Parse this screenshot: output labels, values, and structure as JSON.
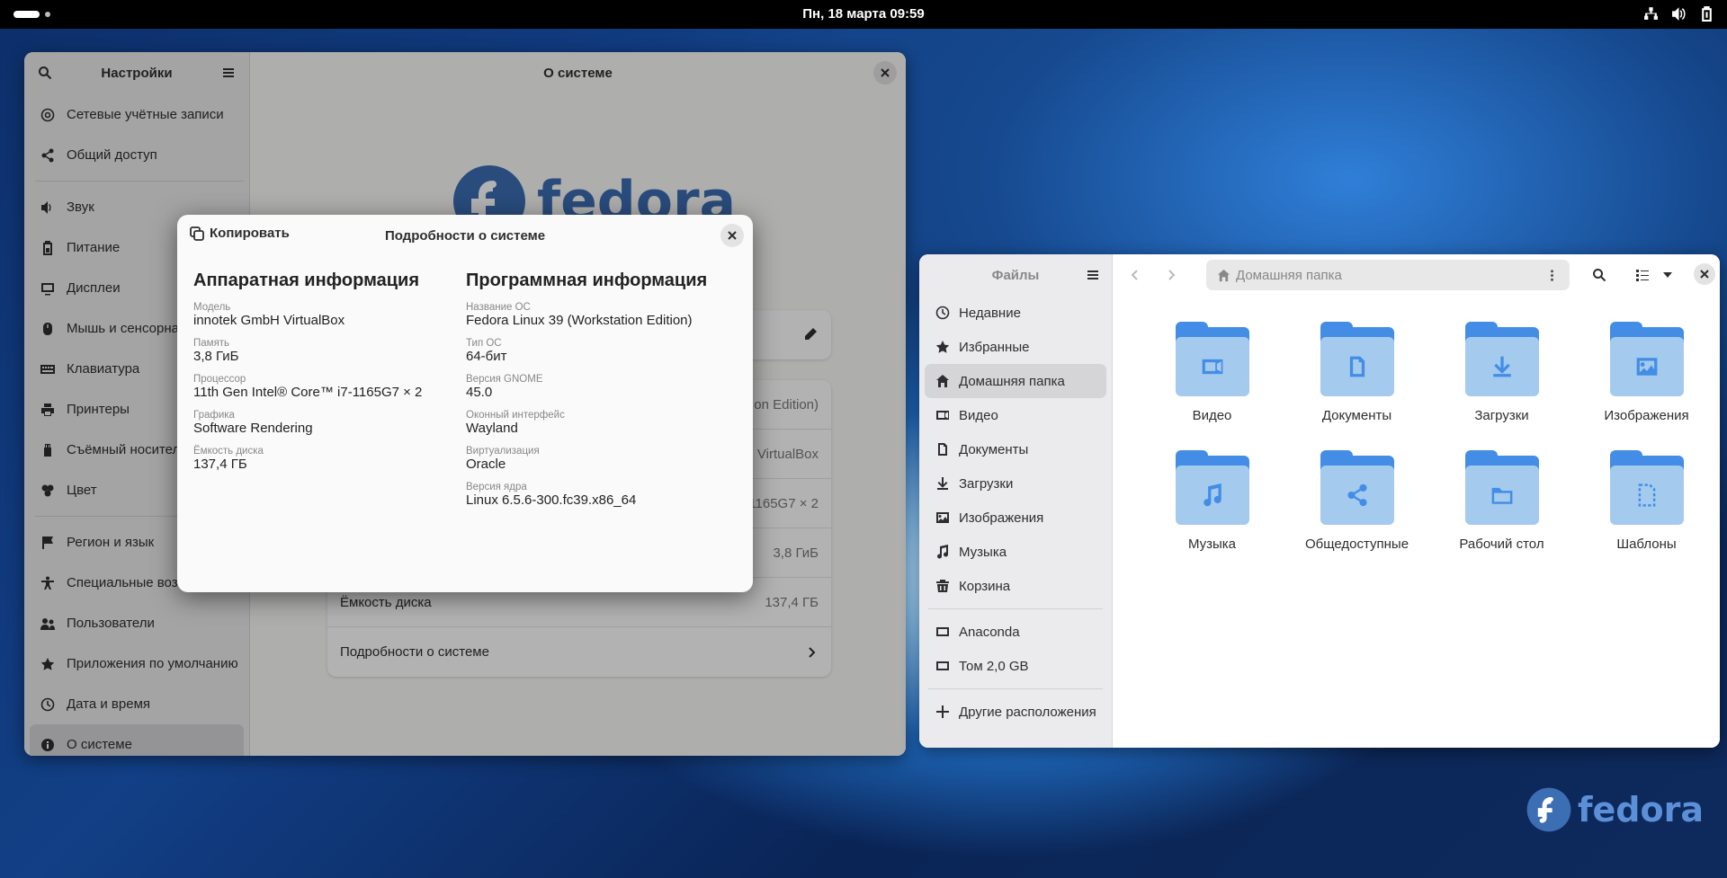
{
  "topbar": {
    "clock": "Пн, 18 марта  09:59"
  },
  "settings": {
    "title": "Настройки",
    "page_title": "О системе",
    "sidebar": [
      {
        "label": "Сетевые учётные записи",
        "icon": "at-icon"
      },
      {
        "label": "Общий доступ",
        "icon": "share-icon"
      },
      {
        "sep": true
      },
      {
        "label": "Звук",
        "icon": "speaker-icon"
      },
      {
        "label": "Питание",
        "icon": "battery-icon"
      },
      {
        "label": "Дисплеи",
        "icon": "display-icon"
      },
      {
        "label": "Мышь и сенсорная",
        "icon": "mouse-icon"
      },
      {
        "label": "Клавиатура",
        "icon": "keyboard-icon"
      },
      {
        "label": "Принтеры",
        "icon": "printer-icon"
      },
      {
        "label": "Съёмный носитель",
        "icon": "usb-icon"
      },
      {
        "label": "Цвет",
        "icon": "color-icon"
      },
      {
        "sep": true
      },
      {
        "label": "Регион и язык",
        "icon": "flag-icon"
      },
      {
        "label": "Специальные возм",
        "icon": "accessibility-icon"
      },
      {
        "label": "Пользователи",
        "icon": "users-icon"
      },
      {
        "label": "Приложения по умолчанию",
        "icon": "star-icon"
      },
      {
        "label": "Дата и время",
        "icon": "clock-icon"
      },
      {
        "label": "О системе",
        "icon": "info-icon",
        "active": true
      }
    ],
    "fedora_word": "fedora",
    "rows": [
      {
        "label": "",
        "value": "on Edition)"
      },
      {
        "label": "",
        "value": "VirtualBox"
      },
      {
        "label": "",
        "value": "1165G7 × 2"
      },
      {
        "label": "",
        "value": "3,8 ГиБ"
      },
      {
        "label": "Ёмкость диска",
        "value": "137,4 ГБ"
      }
    ],
    "details_row": "Подробности о системе"
  },
  "dialog": {
    "copy_label": "Копировать",
    "title": "Подробности о системе",
    "hardware": {
      "heading": "Аппаратная информация",
      "fields": [
        {
          "label": "Модель",
          "value": "innotek GmbH VirtualBox"
        },
        {
          "label": "Память",
          "value": "3,8 ГиБ"
        },
        {
          "label": "Процессор",
          "value": "11th Gen Intel® Core™ i7-1165G7 × 2"
        },
        {
          "label": "Графика",
          "value": "Software Rendering"
        },
        {
          "label": "Ёмкость диска",
          "value": "137,4 ГБ"
        }
      ]
    },
    "software": {
      "heading": "Программная информация",
      "fields": [
        {
          "label": "Название ОС",
          "value": "Fedora Linux 39 (Workstation Edition)"
        },
        {
          "label": "Тип ОС",
          "value": "64-бит"
        },
        {
          "label": "Версия GNOME",
          "value": "45.0"
        },
        {
          "label": "Оконный интерфейс",
          "value": "Wayland"
        },
        {
          "label": "Виртуализация",
          "value": "Oracle"
        },
        {
          "label": "Версия ядра",
          "value": "Linux 6.5.6-300.fc39.x86_64"
        }
      ]
    }
  },
  "files": {
    "title": "Файлы",
    "path": "Домашняя папка",
    "sidebar": [
      {
        "label": "Недавние",
        "icon": "recent-icon"
      },
      {
        "label": "Избранные",
        "icon": "star-icon"
      },
      {
        "label": "Домашняя папка",
        "icon": "home-icon",
        "active": true
      },
      {
        "label": "Видео",
        "icon": "video-icon"
      },
      {
        "label": "Документы",
        "icon": "document-icon"
      },
      {
        "label": "Загрузки",
        "icon": "download-icon"
      },
      {
        "label": "Изображения",
        "icon": "image-icon"
      },
      {
        "label": "Музыка",
        "icon": "music-icon"
      },
      {
        "label": "Корзина",
        "icon": "trash-icon"
      },
      {
        "sep": true
      },
      {
        "label": "Anaconda",
        "icon": "drive-icon"
      },
      {
        "label": "Том 2,0 GB",
        "icon": "drive-icon"
      },
      {
        "sep": true
      },
      {
        "label": "Другие расположения",
        "icon": "plus-icon"
      }
    ],
    "folders": [
      {
        "label": "Видео",
        "icon": "video-icon"
      },
      {
        "label": "Документы",
        "icon": "document-icon"
      },
      {
        "label": "Загрузки",
        "icon": "download-icon"
      },
      {
        "label": "Изображения",
        "icon": "image-icon"
      },
      {
        "label": "Музыка",
        "icon": "music-icon"
      },
      {
        "label": "Общедоступные",
        "icon": "share-icon"
      },
      {
        "label": "Рабочий стол",
        "icon": "folder-icon"
      },
      {
        "label": "Шаблоны",
        "icon": "template-icon"
      }
    ]
  },
  "desktop": {
    "fedora_word": "fedora"
  }
}
